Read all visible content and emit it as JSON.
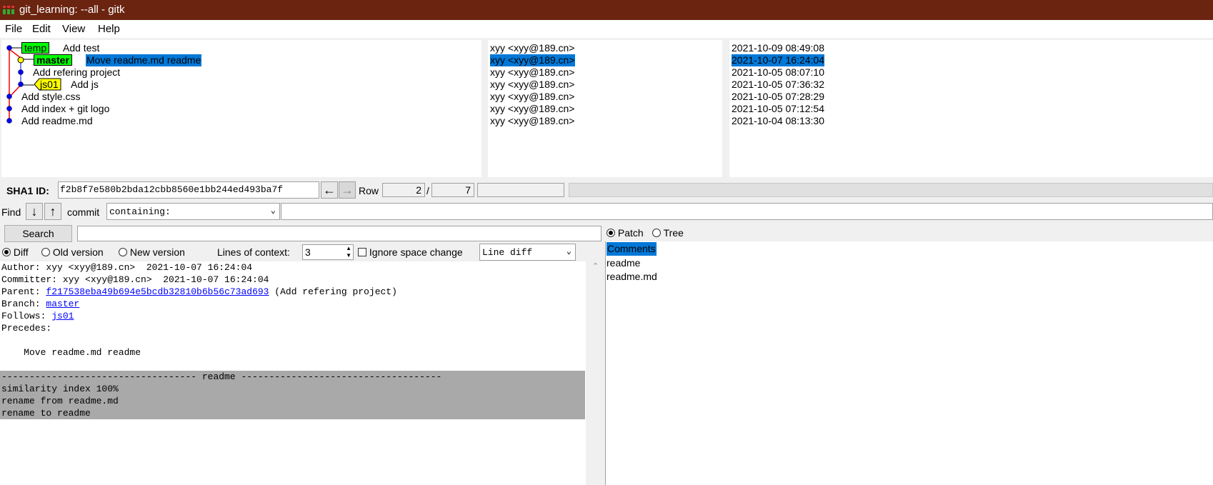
{
  "window": {
    "title": "git_learning: --all - gitk"
  },
  "menu": [
    "File",
    "Edit",
    "View",
    "Help"
  ],
  "commits": [
    {
      "message": "Add test",
      "author": "xyy <xyy@189.cn>",
      "date": "2021-10-09 08:49:08",
      "refs": [
        "temp"
      ]
    },
    {
      "message": "Move readme.md readme",
      "author": "xyy <xyy@189.cn>",
      "date": "2021-10-07 16:24:04",
      "refs": [
        "master"
      ],
      "selected": true
    },
    {
      "message": "Add refering project",
      "author": "xyy <xyy@189.cn>",
      "date": "2021-10-05 08:07:10",
      "refs": []
    },
    {
      "message": "Add js",
      "author": "xyy <xyy@189.cn>",
      "date": "2021-10-05 07:36:32",
      "refs": [
        "js01"
      ]
    },
    {
      "message": "Add style.css",
      "author": "xyy <xyy@189.cn>",
      "date": "2021-10-05 07:28:29",
      "refs": []
    },
    {
      "message": "Add index + git logo",
      "author": "xyy <xyy@189.cn>",
      "date": "2021-10-05 07:12:54",
      "refs": []
    },
    {
      "message": "Add readme.md",
      "author": "xyy <xyy@189.cn>",
      "date": "2021-10-04 08:13:30",
      "refs": []
    }
  ],
  "sha": {
    "label": "SHA1 ID:",
    "value": "f2b8f7e580b2bda12cbb8560e1bb244ed493ba7f",
    "row_label": "Row",
    "row_current": "2",
    "row_sep": "/",
    "row_total": "7"
  },
  "find": {
    "label": "Find",
    "type_label": "commit",
    "mode": "containing:"
  },
  "search": {
    "button": "Search",
    "value": ""
  },
  "view_options": {
    "diff": "Diff",
    "old_version": "Old version",
    "new_version": "New version",
    "context_label": "Lines of context:",
    "context_value": "3",
    "ignore_space": "Ignore space change",
    "diff_mode": "Line diff"
  },
  "right_toggle": {
    "patch": "Patch",
    "tree": "Tree"
  },
  "details": {
    "author": "Author: xyy <xyy@189.cn>  2021-10-07 16:24:04",
    "committer": "Committer: xyy <xyy@189.cn>  2021-10-07 16:24:04",
    "parent_label": "Parent: ",
    "parent_sha": "f217538eba49b694e5bcdb32810b6b56c73ad693",
    "parent_msg": " (Add refering project)",
    "branch_label": "Branch: ",
    "branch": "master",
    "follows_label": "Follows: ",
    "follows": "js01",
    "precedes": "Precedes:",
    "message": "    Move readme.md readme",
    "file_header": "----------------------------------- readme ------------------------------------",
    "diff_lines": [
      "similarity index 100%",
      "rename from readme.md",
      "rename to readme"
    ]
  },
  "files": [
    "Comments",
    "readme",
    "readme.md"
  ],
  "colors": {
    "titlebar": "#6b2410",
    "selection": "#0078d7",
    "temp_ref": "#00ff00",
    "master_ref": "#00ff00",
    "tag_ref": "#ffff00",
    "graph_line": "#ff0000",
    "graph_node": "#0000ff"
  }
}
